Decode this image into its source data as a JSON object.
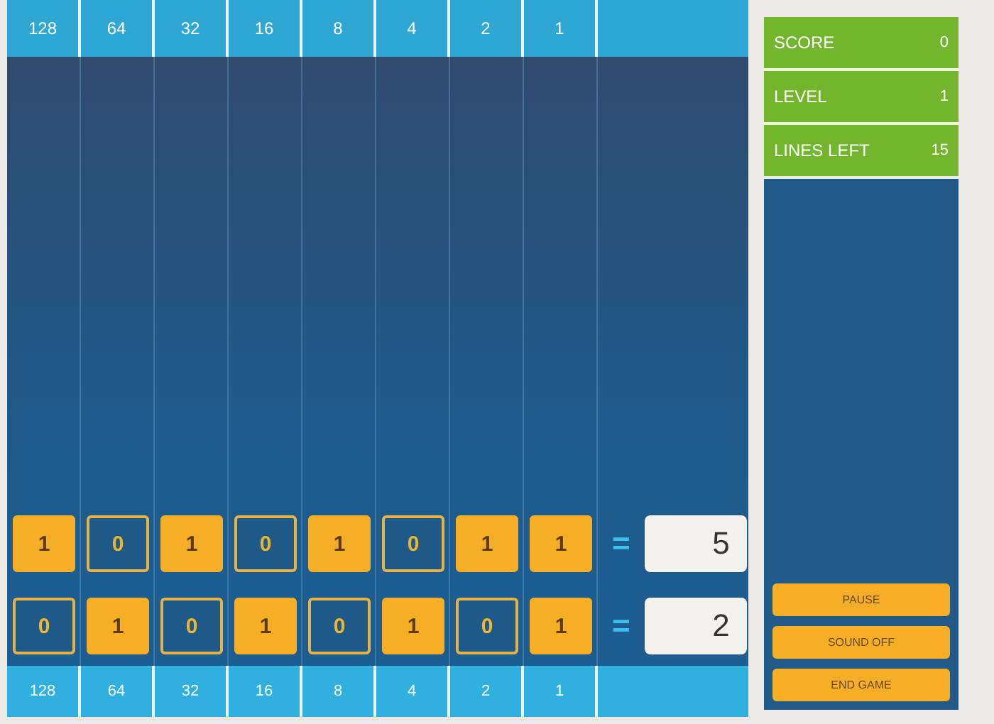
{
  "header": [
    "128",
    "64",
    "32",
    "16",
    "8",
    "4",
    "2",
    "1"
  ],
  "rows": [
    {
      "bits": [
        {
          "value": "1",
          "on": true
        },
        {
          "value": "0",
          "on": false
        },
        {
          "value": "1",
          "on": true
        },
        {
          "value": "0",
          "on": false
        },
        {
          "value": "1",
          "on": true
        },
        {
          "value": "0",
          "on": false
        },
        {
          "value": "1",
          "on": true
        },
        {
          "value": "1",
          "on": true
        }
      ],
      "equals": "=",
      "result": "5"
    },
    {
      "bits": [
        {
          "value": "0",
          "on": false
        },
        {
          "value": "1",
          "on": true
        },
        {
          "value": "0",
          "on": false
        },
        {
          "value": "1",
          "on": true
        },
        {
          "value": "0",
          "on": false
        },
        {
          "value": "1",
          "on": true
        },
        {
          "value": "0",
          "on": false
        },
        {
          "value": "1",
          "on": true
        }
      ],
      "equals": "=",
      "result": "2"
    }
  ],
  "footer": [
    "128",
    "64",
    "32",
    "16",
    "8",
    "4",
    "2",
    "1"
  ],
  "stats": [
    {
      "label": "SCORE",
      "value": "0"
    },
    {
      "label": "LEVEL",
      "value": "1"
    },
    {
      "label": "LINES LEFT",
      "value": "15"
    }
  ],
  "buttons": [
    "PAUSE",
    "SOUND OFF",
    "END GAME"
  ]
}
